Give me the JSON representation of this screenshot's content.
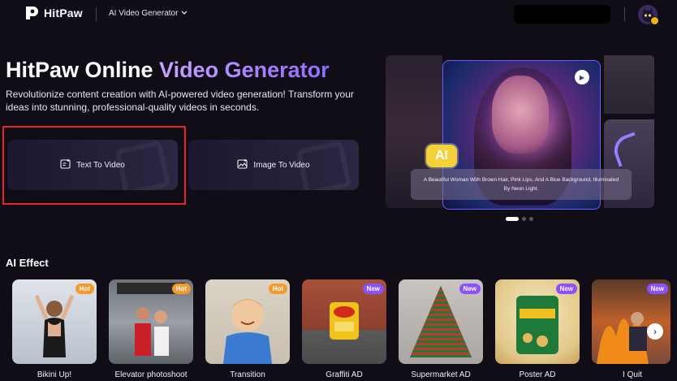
{
  "header": {
    "logo_text": "HitPaw",
    "product_menu": "AI Video Generator",
    "product_menu_icon": "chevron-down-icon"
  },
  "hero": {
    "title_plain": "HitPaw Online",
    "title_accent": "Video Generator",
    "description": "Revolutionize content creation with AI-powered video generation! Transform your ideas into stunning, professional-quality videos in seconds.",
    "cards": [
      {
        "label": "Text To Video",
        "icon": "text-to-video-icon"
      },
      {
        "label": "Image To Video",
        "icon": "image-to-video-icon"
      }
    ]
  },
  "carousel": {
    "badge": "AI",
    "caption": "A Beautiful Woman With Brown Hair, Pink Lips, And A Blue Background, Illuminated By Neon Light.",
    "active_slide": 1,
    "slide_count": 3
  },
  "ai_effect": {
    "title": "AI Effect",
    "items": [
      {
        "label": "Bikini Up!",
        "badge": "Hot"
      },
      {
        "label": "Elevator photoshoot",
        "badge": "Hot"
      },
      {
        "label": "Transition",
        "badge": "Hot"
      },
      {
        "label": "Graffiti AD",
        "badge": "New"
      },
      {
        "label": "Supermarket AD",
        "badge": "New"
      },
      {
        "label": "Poster AD",
        "badge": "New"
      },
      {
        "label": "I Quit",
        "badge": "New"
      }
    ],
    "next_icon": "chevron-right-icon"
  },
  "colors": {
    "background": "#100d17",
    "accent": "#8f6bff",
    "hot_badge": "#f39a2b",
    "new_badge": "#8a52ff",
    "highlight_box": "#e32431"
  }
}
